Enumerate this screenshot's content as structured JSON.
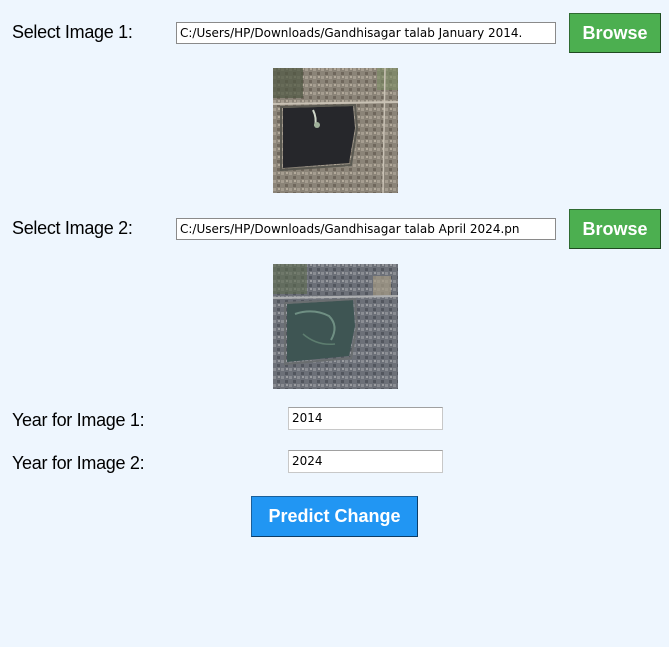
{
  "image1": {
    "label": "Select Image 1:",
    "path": "C:/Users/HP/Downloads/Gandhisagar talab January 2014.",
    "browse_label": "Browse",
    "thumbnail_icon": "satellite-image-lake-2014"
  },
  "image2": {
    "label": "Select Image 2:",
    "path": "C:/Users/HP/Downloads/Gandhisagar talab April 2024.pn",
    "browse_label": "Browse",
    "thumbnail_icon": "satellite-image-lake-2024"
  },
  "year1": {
    "label": "Year for Image 1:",
    "value": "2014"
  },
  "year2": {
    "label": "Year for Image 2:",
    "value": "2024"
  },
  "predict_label": "Predict Change",
  "colors": {
    "background": "#eef6fe",
    "browse_button": "#4caf50",
    "predict_button": "#2196f3"
  }
}
